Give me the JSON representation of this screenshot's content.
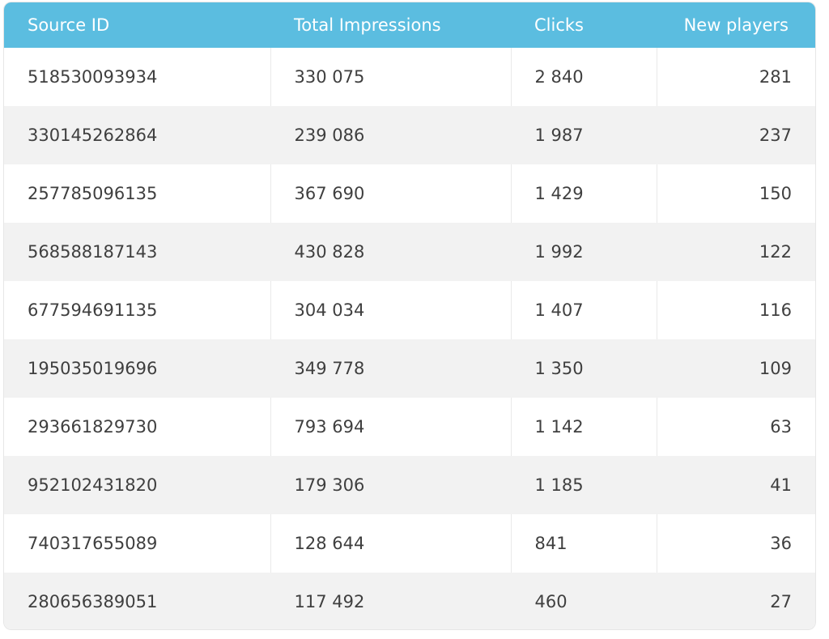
{
  "table": {
    "headers": [
      "Source ID",
      "Total Impressions",
      "Clicks",
      "New players"
    ],
    "rows": [
      [
        "518530093934",
        "330 075",
        "2 840",
        "281"
      ],
      [
        "330145262864",
        "239 086",
        "1 987",
        "237"
      ],
      [
        "257785096135",
        "367 690",
        "1 429",
        "150"
      ],
      [
        "568588187143",
        "430 828",
        "1 992",
        "122"
      ],
      [
        "677594691135",
        "304 034",
        "1 407",
        "116"
      ],
      [
        "195035019696",
        "349 778",
        "1 350",
        "109"
      ],
      [
        "293661829730",
        "793 694",
        "1 142",
        "63"
      ],
      [
        "952102431820",
        "179 306",
        "1 185",
        "41"
      ],
      [
        "740317655089",
        "128 644",
        "841",
        "36"
      ],
      [
        "280656389051",
        "117 492",
        "460",
        "27"
      ]
    ]
  },
  "colors": {
    "header_bg": "#5bbde0",
    "header_text": "#ffffff",
    "stripe_bg": "#f2f2f2",
    "row_text": "#3f3f3f"
  }
}
